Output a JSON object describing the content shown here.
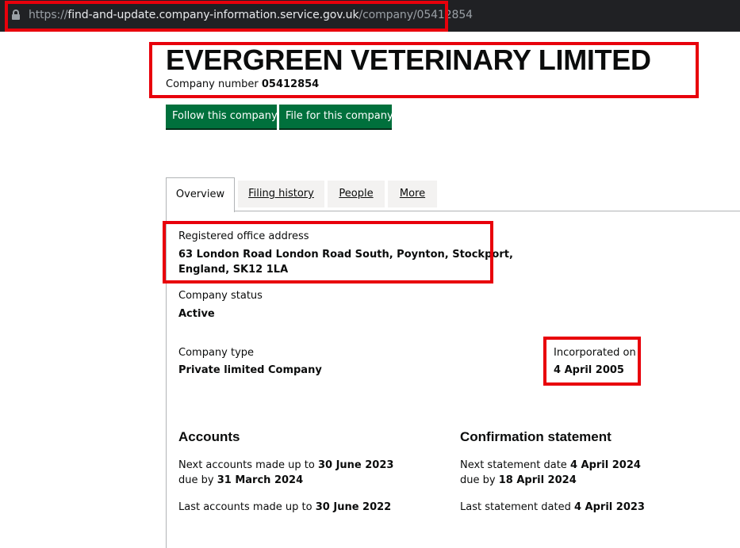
{
  "browser": {
    "url_scheme": "https://",
    "url_host": "find-and-update.company-information.service.gov.uk",
    "url_path": "/company/05412854"
  },
  "header": {
    "company_name": "EVERGREEN VETERINARY LIMITED",
    "company_number_label": "Company number",
    "company_number": "05412854"
  },
  "actions": {
    "follow_label": "Follow this company",
    "file_label": "File for this company"
  },
  "tabs": [
    {
      "label": "Overview"
    },
    {
      "label": "Filing history"
    },
    {
      "label": "People"
    },
    {
      "label": "More"
    }
  ],
  "overview": {
    "registered_office_label": "Registered office address",
    "registered_office_line1": "63 London Road London Road South, Poynton, Stockport,",
    "registered_office_line2": "England, SK12 1LA",
    "status_label": "Company status",
    "status_value": "Active",
    "type_label": "Company type",
    "type_value": "Private limited Company",
    "incorporated_label": "Incorporated on",
    "incorporated_value": "4 April 2005"
  },
  "accounts": {
    "title": "Accounts",
    "next_prefix": "Next accounts made up to",
    "next_date": "30 June 2023",
    "due_prefix": "due by",
    "due_date": "31 March 2024",
    "last_prefix": "Last accounts made up to",
    "last_date": "30 June 2022"
  },
  "confirmation": {
    "title": "Confirmation statement",
    "next_prefix": "Next statement date",
    "next_date": "4 April 2024",
    "due_prefix": "due by",
    "due_date": "18 April 2024",
    "last_prefix": "Last statement dated",
    "last_date": "4 April 2023"
  },
  "colors": {
    "highlight": "#e8000b",
    "button_green": "#00703c",
    "address_bar": "#202124"
  },
  "icons": {
    "lock": "lock-icon"
  }
}
